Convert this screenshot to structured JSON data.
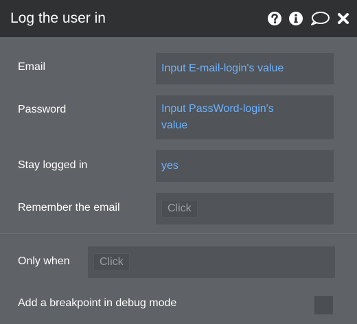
{
  "header": {
    "title": "Log the user in",
    "icons": [
      "help-icon",
      "info-icon",
      "comment-icon",
      "close-icon"
    ]
  },
  "fields": {
    "email": {
      "label": "Email",
      "value": "Input E-mail-login's value"
    },
    "password": {
      "label": "Password",
      "value_line1": "Input PassWord-login's",
      "value_line2": "value"
    },
    "stay_logged_in": {
      "label": "Stay logged in",
      "value": "yes"
    },
    "remember_email": {
      "label": "Remember the email",
      "button": "Click"
    }
  },
  "conditions": {
    "only_when": {
      "label": "Only when",
      "button": "Click"
    },
    "breakpoint": {
      "label": "Add a breakpoint in debug mode",
      "checked": false
    }
  },
  "colors": {
    "header_bg": "#2f3133",
    "panel_bg": "#5f6266",
    "field_bg": "#515458",
    "value_text": "#6cb2ff"
  }
}
